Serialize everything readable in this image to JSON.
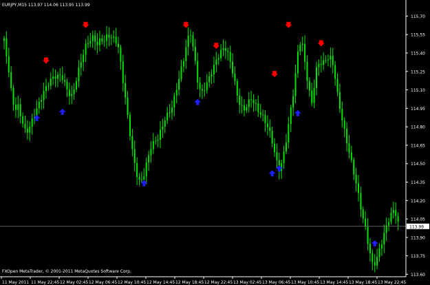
{
  "header": {
    "title": "EURJPY,M15  113.97 114.06 113.95 113.99"
  },
  "footer": {
    "copyright": "FXOpen MetaTrader, © 2001-2011 MetaQuotes Software Corp."
  },
  "colors": {
    "background": "#000000",
    "candles": "#00e400",
    "axis": "#ffffff",
    "sell_arrow": "#ff0000",
    "buy_arrow": "#1e1eff",
    "price_line": "#7a7a7a",
    "current_price_bg": "#ffffff",
    "current_price_text": "#000000"
  },
  "chart_data": {
    "type": "candlestick",
    "symbol": "EURJPY",
    "timeframe": "M15",
    "last_price": "113.99",
    "ylim": [
      113.58,
      115.82
    ],
    "y_ticks": [
      "115.70",
      "115.55",
      "115.40",
      "115.25",
      "115.10",
      "114.95",
      "114.80",
      "114.65",
      "114.50",
      "114.35",
      "114.20",
      "114.05",
      "113.90",
      "113.75",
      "113.60"
    ],
    "x_ticks": [
      "11 May 2011",
      "11 May 22:45",
      "12 May 02:45",
      "12 May 06:45",
      "12 May 10:45",
      "12 May 14:45",
      "12 May 18:45",
      "12 May 22:45",
      "13 May 02:45",
      "13 May 06:45",
      "13 May 10:45",
      "13 May 14:45",
      "13 May 18:45",
      "13 May 22:45"
    ],
    "series_close_approx": [
      115.5,
      115.3,
      115.05,
      114.9,
      114.95,
      114.85,
      114.78,
      114.82,
      114.9,
      114.95,
      115.0,
      115.05,
      115.1,
      115.15,
      115.2,
      115.22,
      115.25,
      115.18,
      115.1,
      115.05,
      115.15,
      115.25,
      115.35,
      115.45,
      115.5,
      115.55,
      115.5,
      115.55,
      115.52,
      115.55,
      115.5,
      115.48,
      115.4,
      115.2,
      115.0,
      114.8,
      114.6,
      114.45,
      114.35,
      114.4,
      114.5,
      114.6,
      114.65,
      114.7,
      114.8,
      114.9,
      114.95,
      115.0,
      115.1,
      115.2,
      115.3,
      115.45,
      115.55,
      115.4,
      115.2,
      115.1,
      115.15,
      115.2,
      115.25,
      115.3,
      115.35,
      115.4,
      115.42,
      115.35,
      115.25,
      115.1,
      115.0,
      114.95,
      114.98,
      115.0,
      114.95,
      114.9,
      114.88,
      114.85,
      114.8,
      114.7,
      114.55,
      114.45,
      114.55,
      114.7,
      114.9,
      115.1,
      115.4,
      115.55,
      115.35,
      115.15,
      115.0,
      115.25,
      115.3,
      115.28,
      115.32,
      115.35,
      115.3,
      115.1,
      114.95,
      114.8,
      114.65,
      114.5,
      114.35,
      114.2,
      114.05,
      113.95,
      113.8,
      113.7,
      113.75,
      113.85,
      113.92,
      114.0,
      114.05,
      114.1,
      113.99
    ],
    "sell_signals": [
      {
        "index": 18,
        "price": 115.33
      },
      {
        "index": 35,
        "price": 115.62
      },
      {
        "index": 78,
        "price": 115.62
      },
      {
        "index": 91,
        "price": 115.45
      },
      {
        "index": 116,
        "price": 115.22
      },
      {
        "index": 122,
        "price": 115.62
      },
      {
        "index": 136,
        "price": 115.47
      }
    ],
    "buy_signals": [
      {
        "index": 14,
        "price": 114.88
      },
      {
        "index": 25,
        "price": 114.93
      },
      {
        "index": 60,
        "price": 114.35
      },
      {
        "index": 83,
        "price": 115.01
      },
      {
        "index": 115,
        "price": 114.43
      },
      {
        "index": 118,
        "price": 114.47
      },
      {
        "index": 126,
        "price": 114.92
      },
      {
        "index": 159,
        "price": 113.86
      }
    ]
  }
}
